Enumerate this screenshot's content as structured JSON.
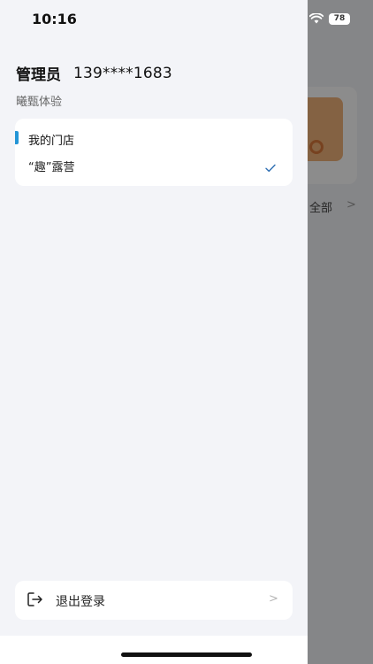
{
  "status_bar": {
    "time": "10:16",
    "battery": "78"
  },
  "header": {
    "role": "管理员",
    "phone": "139****1683",
    "org": "曦甄体验"
  },
  "stores": {
    "title": "我的门店",
    "items": [
      {
        "name": "“趣”露营",
        "selected": true
      }
    ]
  },
  "logout": {
    "label": "退出登录"
  },
  "background_page": {
    "view_all_label": "全部"
  },
  "colors": {
    "accent": "#2395d6",
    "overlay": "rgba(0,0,0,0.45)"
  },
  "icons": {
    "check": "check-icon",
    "logout": "logout-icon",
    "chevron": "chevron-right-icon"
  }
}
